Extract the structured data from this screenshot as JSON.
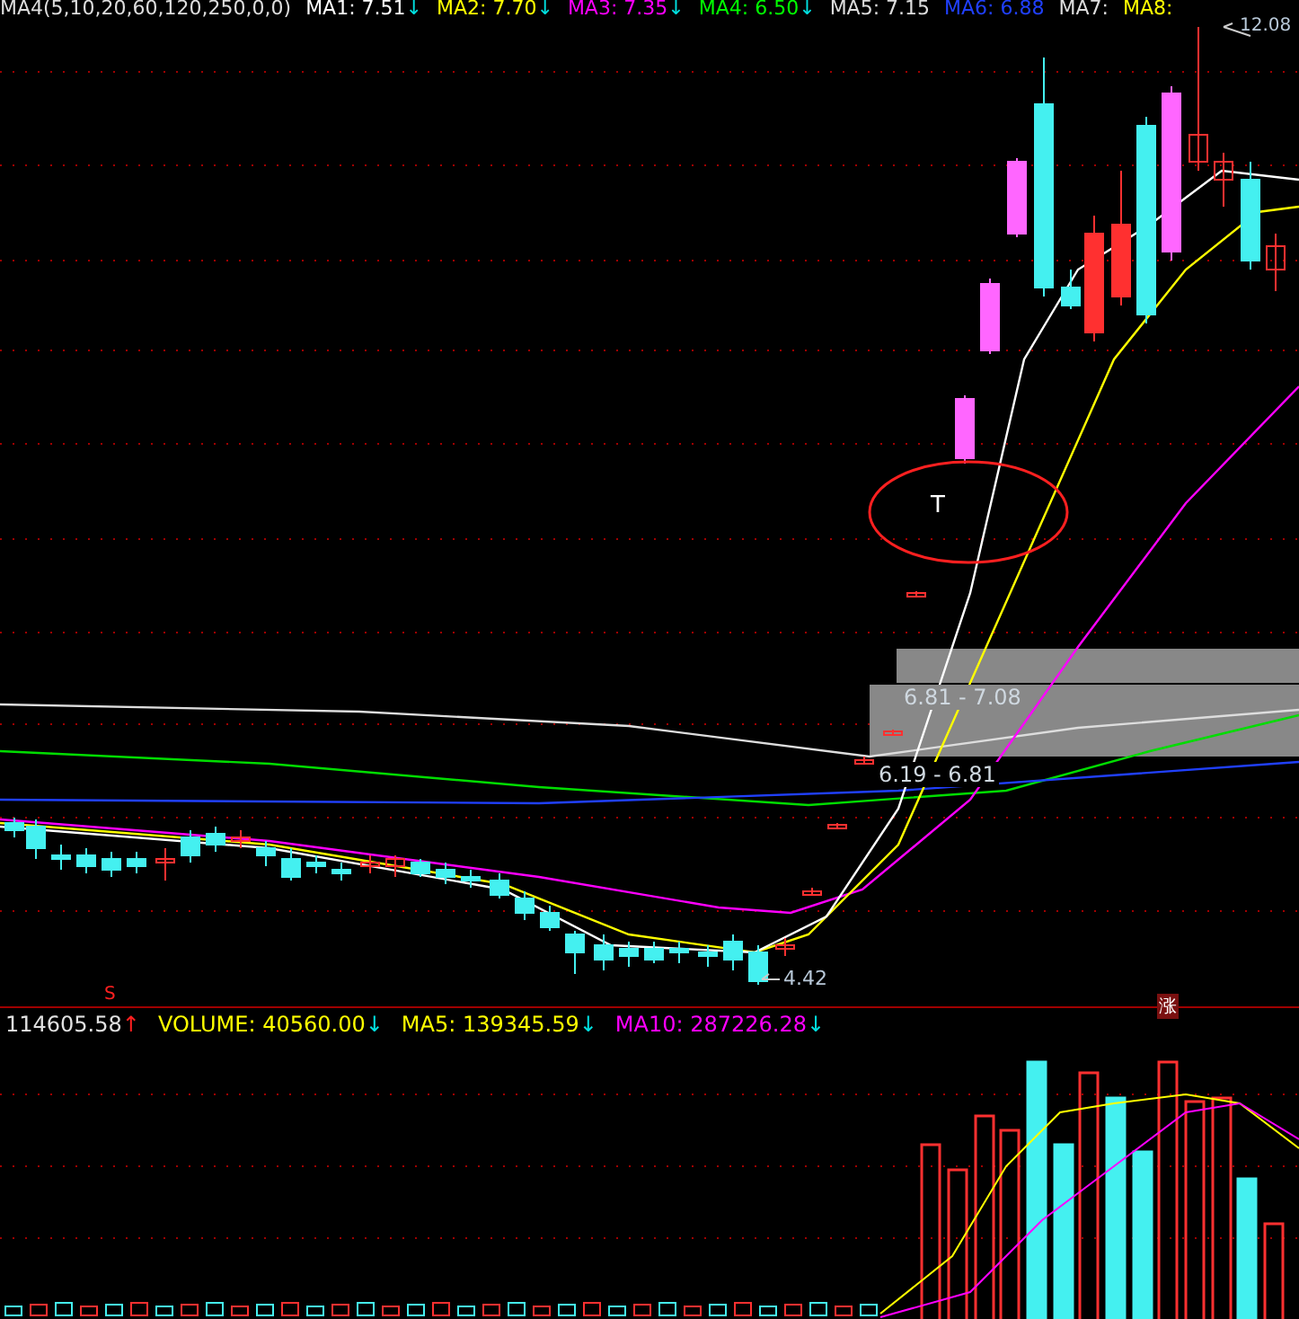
{
  "ma_legend": {
    "title": "MA4(5,10,20,60,120,250,0,0)",
    "items": [
      {
        "label": "MA1: 7.51",
        "color": "#ffffff",
        "arrow": "↓"
      },
      {
        "label": "MA2: 7.70",
        "color": "#ffff00",
        "arrow": "↓"
      },
      {
        "label": "MA3: 7.35",
        "color": "#ff00ff",
        "arrow": "↓"
      },
      {
        "label": "MA4: 6.50",
        "color": "#00ff00",
        "arrow": "↓"
      },
      {
        "label": "MA5: 7.15",
        "color": "#dddddd"
      },
      {
        "label": "MA6: 6.88",
        "color": "#2040ff"
      },
      {
        "label": "MA7:",
        "color": "#dddddd"
      },
      {
        "label": "MA8:",
        "color": "#ffff00"
      }
    ]
  },
  "price_labels": {
    "high": "12.08",
    "low": "4.42"
  },
  "zones": [
    {
      "label": "6.81 - 7.08"
    },
    {
      "label": "6.19 - 6.81"
    }
  ],
  "signal_marks": {
    "buy": "T",
    "s_mark": "S",
    "rise_mark": "涨"
  },
  "volume_legend": {
    "total": "114605.58",
    "total_arrow": "↑",
    "items": [
      {
        "label": "VOLUME: 40560.00",
        "color": "#ffff00",
        "arrow": "↓"
      },
      {
        "label": "MA5: 139345.59",
        "color": "#ffff00",
        "arrow": "↓"
      },
      {
        "label": "MA10: 287226.28",
        "color": "#ff00ff",
        "arrow": "↓"
      }
    ]
  }
}
